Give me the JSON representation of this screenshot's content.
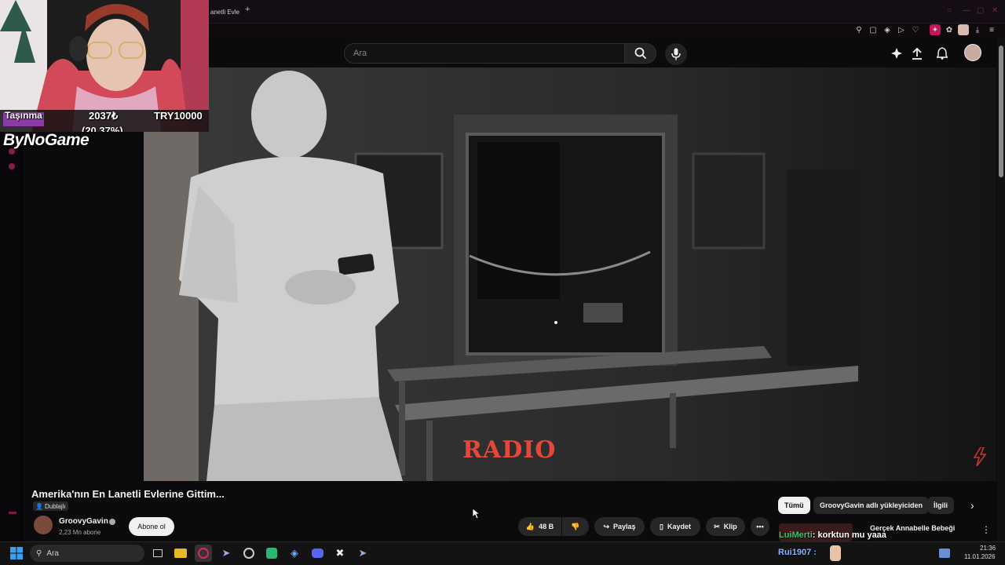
{
  "browser": {
    "tab_title": "anetli Evle",
    "new_tab": "+"
  },
  "search": {
    "placeholder": "Ara"
  },
  "webcam": {
    "label_left": "Taşınma",
    "amount": "2037₺",
    "percent": "(20.37%)",
    "goal": "TRY10000"
  },
  "brand": {
    "name": "ByNoGame"
  },
  "player": {
    "overlay_text": "RADIO"
  },
  "video": {
    "title": "Amerika'nın En Lanetli Evlerine Gittim...",
    "dub_label": "Dublajlı",
    "channel_name": "GroovyGavin",
    "subscribers": "2,23 Mn abone",
    "subscribe_label": "Abone ol",
    "like_count": "48 B",
    "share_label": "Paylaş",
    "save_label": "Kaydet",
    "clip_label": "Klip"
  },
  "chips": {
    "all": "Tümü",
    "uploader": "GroovyGavin adlı yükleyiciden",
    "related": "İlgili"
  },
  "related": {
    "title_partial": "Gerçek Annabelle Bebeği"
  },
  "chat": {
    "message1_user": "LuiMerti",
    "message1_text": ": korktun mu yaaa",
    "message2_user": "Rui1907 :"
  },
  "taskbar": {
    "search_placeholder": "Ara",
    "time": "21:36",
    "date": "11.01.2026"
  },
  "colors": {
    "accent": "#e6473a",
    "yt_bg": "#0f0f0f",
    "browser_accent": "#c2185b"
  }
}
